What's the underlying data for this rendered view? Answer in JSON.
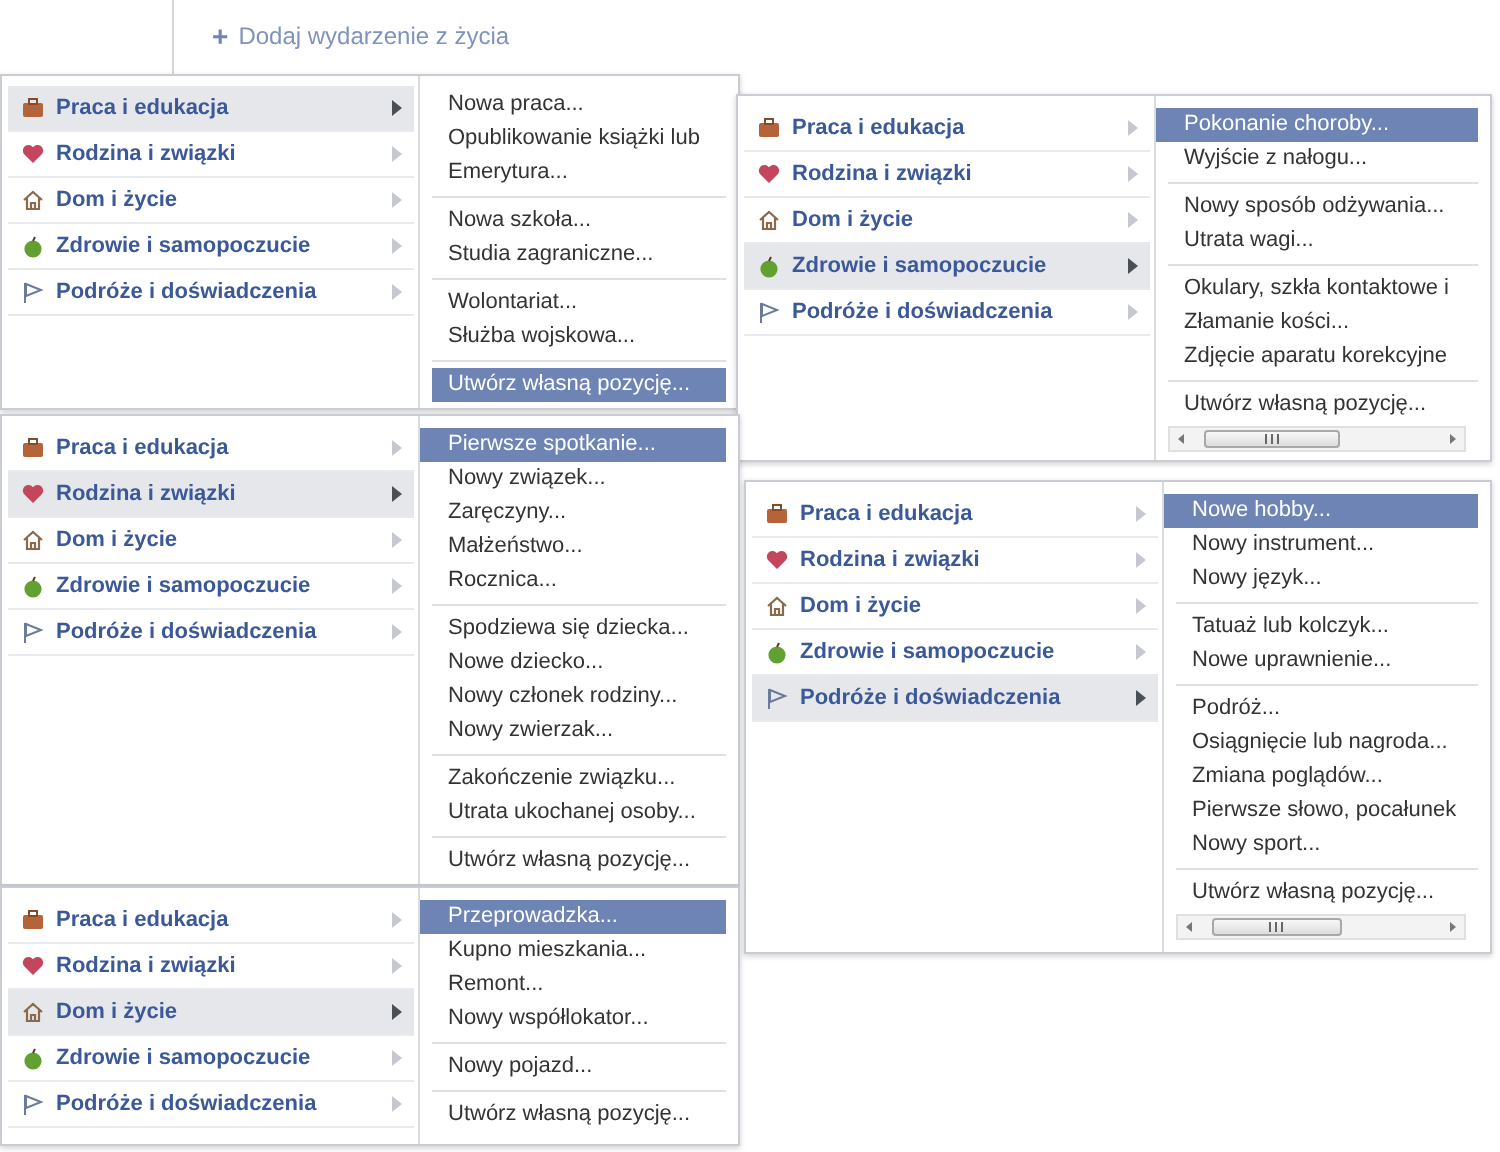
{
  "header": {
    "icon": "+",
    "label": "Dodaj wydarzenie z życia"
  },
  "panels": [
    {
      "categories": [
        {
          "label": "Praca i edukacja",
          "selected": true
        },
        {
          "label": "Rodzina i związki",
          "selected": false
        },
        {
          "label": "Dom i życie",
          "selected": false
        },
        {
          "label": "Zdrowie i samopoczucie",
          "selected": false
        },
        {
          "label": "Podróże i doświadczenia",
          "selected": false
        }
      ],
      "submenu": [
        [
          {
            "label": "Nowa praca...",
            "selected": false
          },
          {
            "label": "Opublikowanie książki lub",
            "selected": false
          },
          {
            "label": "Emerytura...",
            "selected": false
          }
        ],
        [
          {
            "label": "Nowa szkoła...",
            "selected": false
          },
          {
            "label": "Studia zagraniczne...",
            "selected": false
          }
        ],
        [
          {
            "label": "Wolontariat...",
            "selected": false
          },
          {
            "label": "Służba wojskowa...",
            "selected": false
          }
        ],
        [
          {
            "label": "Utwórz własną pozycję...",
            "selected": true
          }
        ]
      ],
      "scrollbar": false
    },
    {
      "categories": [
        {
          "label": "Praca i edukacja",
          "selected": false
        },
        {
          "label": "Rodzina i związki",
          "selected": false
        },
        {
          "label": "Dom i życie",
          "selected": false
        },
        {
          "label": "Zdrowie i samopoczucie",
          "selected": true
        },
        {
          "label": "Podróże i doświadczenia",
          "selected": false
        }
      ],
      "submenu": [
        [
          {
            "label": "Pokonanie choroby...",
            "selected": true
          },
          {
            "label": "Wyjście z nałogu...",
            "selected": false
          }
        ],
        [
          {
            "label": "Nowy sposób odżywania...",
            "selected": false
          },
          {
            "label": "Utrata wagi...",
            "selected": false
          }
        ],
        [
          {
            "label": "Okulary, szkła kontaktowe i",
            "selected": false
          },
          {
            "label": "Złamanie kości...",
            "selected": false
          },
          {
            "label": "Zdjęcie aparatu korekcyjne",
            "selected": false
          }
        ],
        [
          {
            "label": "Utwórz własną pozycję...",
            "selected": false
          }
        ]
      ],
      "scrollbar": true
    },
    {
      "categories": [
        {
          "label": "Praca i edukacja",
          "selected": false
        },
        {
          "label": "Rodzina i związki",
          "selected": true
        },
        {
          "label": "Dom i życie",
          "selected": false
        },
        {
          "label": "Zdrowie i samopoczucie",
          "selected": false
        },
        {
          "label": "Podróże i doświadczenia",
          "selected": false
        }
      ],
      "submenu": [
        [
          {
            "label": "Pierwsze spotkanie...",
            "selected": true
          },
          {
            "label": "Nowy związek...",
            "selected": false
          },
          {
            "label": "Zaręczyny...",
            "selected": false
          },
          {
            "label": "Małżeństwo...",
            "selected": false
          },
          {
            "label": "Rocznica...",
            "selected": false
          }
        ],
        [
          {
            "label": "Spodziewa się dziecka...",
            "selected": false
          },
          {
            "label": "Nowe dziecko...",
            "selected": false
          },
          {
            "label": "Nowy członek rodziny...",
            "selected": false
          },
          {
            "label": "Nowy zwierzak...",
            "selected": false
          }
        ],
        [
          {
            "label": "Zakończenie związku...",
            "selected": false
          },
          {
            "label": "Utrata ukochanej osoby...",
            "selected": false
          }
        ],
        [
          {
            "label": "Utwórz własną pozycję...",
            "selected": false
          }
        ]
      ],
      "scrollbar": false
    },
    {
      "categories": [
        {
          "label": "Praca i edukacja",
          "selected": false
        },
        {
          "label": "Rodzina i związki",
          "selected": false
        },
        {
          "label": "Dom i życie",
          "selected": false
        },
        {
          "label": "Zdrowie i samopoczucie",
          "selected": false
        },
        {
          "label": "Podróże i doświadczenia",
          "selected": true
        }
      ],
      "submenu": [
        [
          {
            "label": "Nowe hobby...",
            "selected": true
          },
          {
            "label": "Nowy instrument...",
            "selected": false
          },
          {
            "label": "Nowy język...",
            "selected": false
          }
        ],
        [
          {
            "label": "Tatuaż lub kolczyk...",
            "selected": false
          },
          {
            "label": "Nowe uprawnienie...",
            "selected": false
          }
        ],
        [
          {
            "label": "Podróż...",
            "selected": false
          },
          {
            "label": "Osiągnięcie lub nagroda...",
            "selected": false
          },
          {
            "label": "Zmiana poglądów...",
            "selected": false
          },
          {
            "label": "Pierwsze słowo, pocałunek",
            "selected": false
          },
          {
            "label": "Nowy sport...",
            "selected": false
          }
        ],
        [
          {
            "label": "Utwórz własną pozycję...",
            "selected": false
          }
        ]
      ],
      "scrollbar": true
    },
    {
      "categories": [
        {
          "label": "Praca i edukacja",
          "selected": false
        },
        {
          "label": "Rodzina i związki",
          "selected": false
        },
        {
          "label": "Dom i życie",
          "selected": true
        },
        {
          "label": "Zdrowie i samopoczucie",
          "selected": false
        },
        {
          "label": "Podróże i doświadczenia",
          "selected": false
        }
      ],
      "submenu": [
        [
          {
            "label": "Przeprowadzka...",
            "selected": true
          },
          {
            "label": "Kupno mieszkania...",
            "selected": false
          },
          {
            "label": "Remont...",
            "selected": false
          },
          {
            "label": "Nowy współlokator...",
            "selected": false
          }
        ],
        [
          {
            "label": "Nowy pojazd...",
            "selected": false
          }
        ],
        [
          {
            "label": "Utwórz własną pozycję...",
            "selected": false
          }
        ]
      ],
      "scrollbar": false
    }
  ]
}
